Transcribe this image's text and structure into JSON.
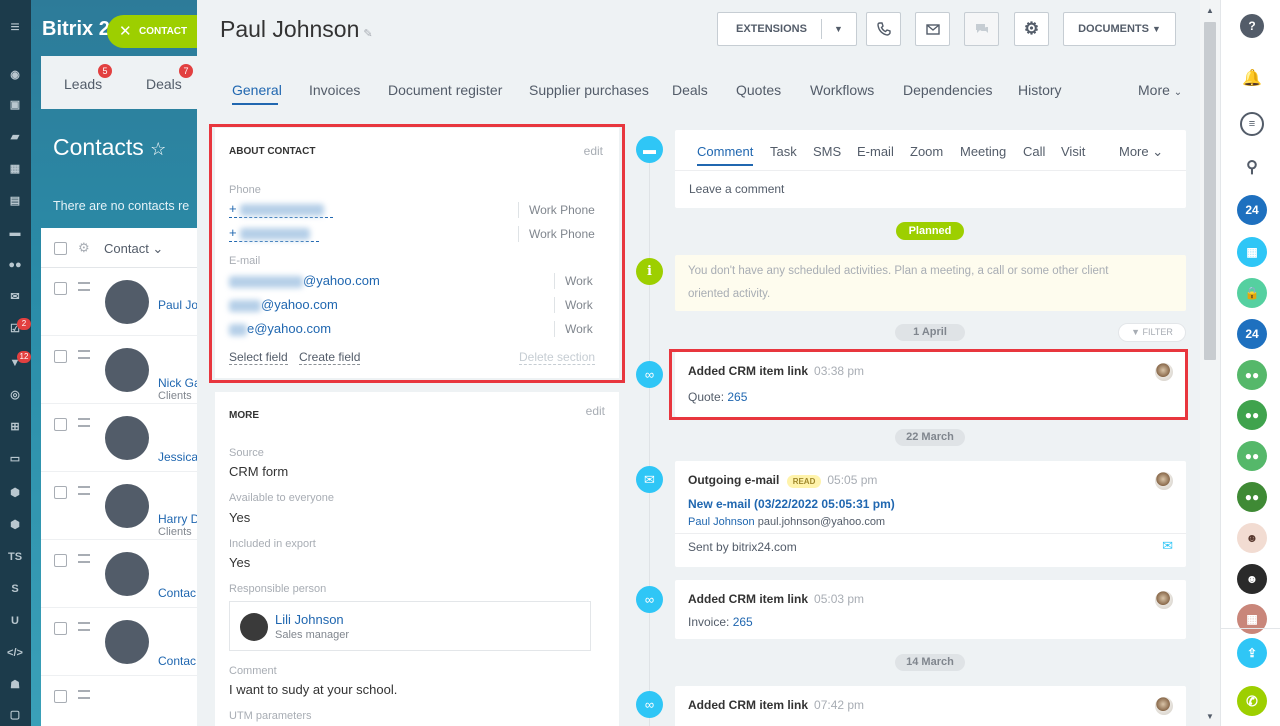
{
  "bg": {
    "brand": "Bitrix",
    "brand_suffix": "2",
    "tab_leads": "Leads",
    "tab_leads_badge": "5",
    "tab_deals": "Deals",
    "tab_deals_badge": "7",
    "title": "Contacts",
    "notice": "There are no contacts re",
    "col_contact": "Contact",
    "rows": [
      {
        "name": "Paul Jo",
        "sub": ""
      },
      {
        "name": "Nick Ga",
        "sub": "Clients"
      },
      {
        "name": "Jessica",
        "sub": ""
      },
      {
        "name": "Harry D",
        "sub": "Clients"
      },
      {
        "name": "Contac",
        "sub": ""
      },
      {
        "name": "Contac",
        "sub": ""
      }
    ],
    "contact_pill": "CONTACT"
  },
  "nav": {
    "badge_tasks": "2",
    "badge_filter": "12",
    "label_ts": "TS",
    "label_s": "S",
    "label_u": "U"
  },
  "header": {
    "title": "Paul Johnson",
    "extensions": "EXTENSIONS",
    "documents": "DOCUMENTS"
  },
  "tabs": [
    "General",
    "Invoices",
    "Document register",
    "Supplier purchases",
    "Deals",
    "Quotes",
    "Workflows",
    "Dependencies",
    "History",
    "More"
  ],
  "about": {
    "title": "ABOUT CONTACT",
    "edit": "edit",
    "phone_label": "Phone",
    "phones": [
      {
        "prefix": "+",
        "type": "Work Phone"
      },
      {
        "prefix": "+",
        "type": "Work Phone"
      }
    ],
    "email_label": "E-mail",
    "emails": [
      {
        "domain": "@yahoo.com",
        "type": "Work"
      },
      {
        "domain": "@yahoo.com",
        "type": "Work"
      },
      {
        "domain": "e@yahoo.com",
        "type": "Work"
      }
    ],
    "select_field": "Select field",
    "create_field": "Create field",
    "delete_section": "Delete section"
  },
  "more": {
    "title": "MORE",
    "edit": "edit",
    "source_label": "Source",
    "source": "CRM form",
    "available_label": "Available to everyone",
    "available": "Yes",
    "export_label": "Included in export",
    "export": "Yes",
    "responsible_label": "Responsible person",
    "responsible_name": "Lili Johnson",
    "responsible_position": "Sales manager",
    "comment_label": "Comment",
    "comment": "I want to sudy at your school.",
    "utm_label": "UTM parameters"
  },
  "activity": {
    "tabs": [
      "Comment",
      "Task",
      "SMS",
      "E-mail",
      "Zoom",
      "Meeting",
      "Call",
      "Visit",
      "More"
    ],
    "placeholder": "Leave a comment",
    "planned": "Planned",
    "no_activities": "You don't have any scheduled activities. Plan a meeting, a call or some other client",
    "no_activities_2": "oriented activity.",
    "filter": "FILTER"
  },
  "timeline": {
    "date1": "1 April",
    "date2": "22 March",
    "date3": "14 March",
    "item1_title": "Added CRM item link",
    "item1_time": "03:38 pm",
    "item1_label": "Quote:",
    "item1_value": "265",
    "item2_title": "Outgoing e-mail",
    "item2_badge": "READ",
    "item2_time": "05:05 pm",
    "item2_subject": "New e-mail (03/22/2022 05:05:31 pm)",
    "item2_from_name": "Paul Johnson",
    "item2_from_email": "paul.johnson@yahoo.com",
    "item2_sent": "Sent by bitrix24.com",
    "item3_title": "Added CRM item link",
    "item3_time": "05:03 pm",
    "item3_label": "Invoice:",
    "item3_value": "265",
    "item4_title": "Added CRM item link",
    "item4_time": "07:42 pm"
  },
  "rbar": {
    "help": "?",
    "b24": "24"
  },
  "colors": {
    "accent": "#2067b0",
    "green": "#9dcf00",
    "cyan": "#2fc6f6",
    "red_frame": "#e8363e",
    "nav_dark": "#1c3b4b"
  }
}
